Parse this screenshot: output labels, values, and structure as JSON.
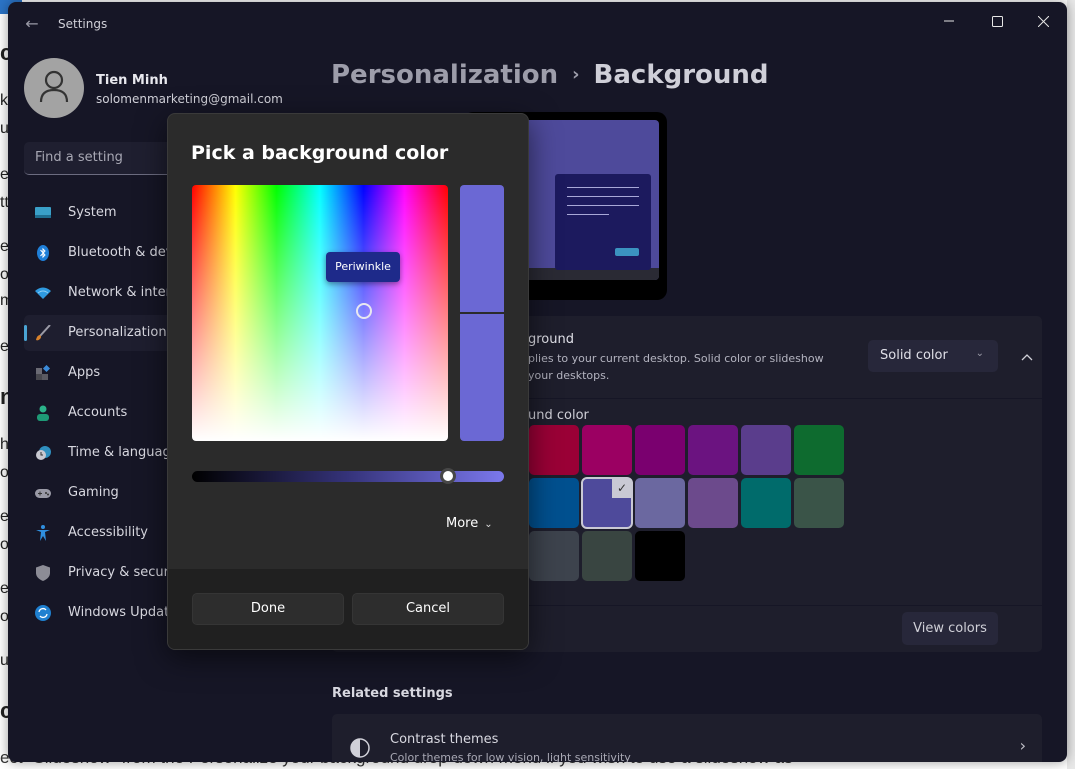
{
  "background_document": {
    "left_fragments": [
      "c",
      "k",
      "u",
      "e",
      "tt",
      "e",
      "op",
      "m",
      "e",
      "n",
      "h",
      "o",
      "e",
      "or",
      "e",
      "oo",
      "u",
      "c"
    ],
    "bottom_text": "ect \"Slideshow\" from the Personalize your background drop-down menu if you wish to use a slideshow as"
  },
  "window": {
    "title": "Settings",
    "back_icon": "back-arrow-icon",
    "controls": {
      "minimize": "minimize-icon",
      "maximize": "maximize-icon",
      "close": "close-icon"
    }
  },
  "user": {
    "name": "Tien Minh",
    "email": "solomenmarketing@gmail.com"
  },
  "search": {
    "placeholder": "Find a setting",
    "value": ""
  },
  "sidebar": {
    "items": [
      {
        "label": "System",
        "icon": "monitor-icon",
        "active": false
      },
      {
        "label": "Bluetooth & devices",
        "icon": "bluetooth-icon",
        "active": false
      },
      {
        "label": "Network & internet",
        "icon": "wifi-icon",
        "active": false
      },
      {
        "label": "Personalization",
        "icon": "brush-icon",
        "active": true
      },
      {
        "label": "Apps",
        "icon": "apps-icon",
        "active": false
      },
      {
        "label": "Accounts",
        "icon": "person-icon",
        "active": false
      },
      {
        "label": "Time & language",
        "icon": "clock-globe-icon",
        "active": false
      },
      {
        "label": "Gaming",
        "icon": "gamepad-icon",
        "active": false
      },
      {
        "label": "Accessibility",
        "icon": "accessibility-icon",
        "active": false
      },
      {
        "label": "Privacy & security",
        "icon": "shield-icon",
        "active": false
      },
      {
        "label": "Windows Update",
        "icon": "update-icon",
        "active": false
      }
    ]
  },
  "breadcrumb": {
    "parent": "Personalization",
    "separator": "›",
    "current": "Background"
  },
  "background_setting": {
    "title": "Personalize your background",
    "visible_title": "ground",
    "description_line1": "plies to your current desktop. Solid color or slideshow",
    "description_line2": "your desktops.",
    "dropdown_value": "Solid color",
    "collapse_icon": "chevron-up-icon"
  },
  "colors_section": {
    "label_visible": "und color",
    "selected_index": 9,
    "swatches": [
      "#a4262c",
      "#9a0036",
      "#9b0062",
      "#7a006f",
      "#6b1380",
      "#5a3d8c",
      "#0e6b2f",
      "#1f6b7d",
      "#00508f",
      "#4e4a9b",
      "#6b68a0",
      "#6c4a8c",
      "#006b6b",
      "#3a5448",
      "#3c3c34",
      "#3d434d",
      "#394541",
      "#000000"
    ]
  },
  "view_colors_label": "View colors",
  "related": {
    "title": "Related settings",
    "items": [
      {
        "title": "Contrast themes",
        "description": "Color themes for low vision, light sensitivity",
        "icon": "contrast-icon"
      }
    ]
  },
  "dialog": {
    "title": "Pick a background color",
    "tooltip": "Periwinkle",
    "selected_color": "#6b68d4",
    "value_slider_percent": 82,
    "more_label": "More",
    "done_label": "Done",
    "cancel_label": "Cancel"
  }
}
